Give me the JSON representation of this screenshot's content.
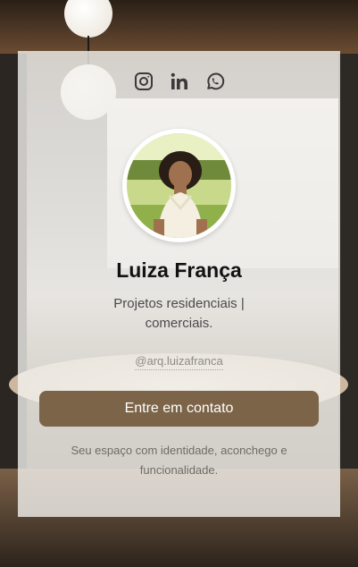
{
  "profile": {
    "name": "Luiza França",
    "subtitle": "Projetos residenciais | comerciais.",
    "handle": "@arq.luizafranca",
    "avatar_alt": "Luiza França"
  },
  "social_links": [
    {
      "icon": "instagram-icon"
    },
    {
      "icon": "linkedin-icon"
    },
    {
      "icon": "whatsapp-icon"
    }
  ],
  "cta": {
    "label": "Entre em contato"
  },
  "tagline": "Seu espaço com identidade, aconchego e funcionalidade.",
  "colors": {
    "accent": "#7c6448",
    "icon": "#3a3a3a",
    "card_bg": "#f3f1ee"
  }
}
